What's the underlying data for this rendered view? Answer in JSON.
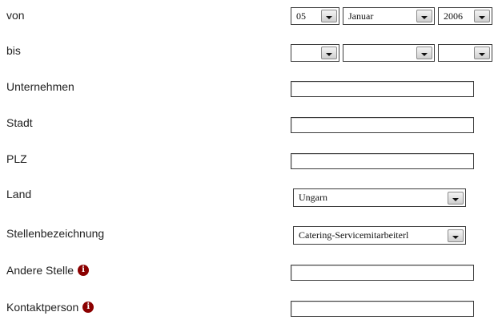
{
  "form": {
    "von_label": "von",
    "bis_label": "bis",
    "von": {
      "day": "05",
      "month": "Januar",
      "year": "2006"
    },
    "bis": {
      "day": "",
      "month": "",
      "year": ""
    },
    "unternehmen_label": "Unternehmen",
    "stadt_label": "Stadt",
    "plz_label": "PLZ",
    "land_label": "Land",
    "land_value": "Ungarn",
    "stellen_label": "Stellenbezeichnung",
    "stellen_value": "Catering-Servicemitarbeiterl",
    "andere_label": "Andere Stelle",
    "kontakt_label": "Kontaktperson",
    "info_glyph": "i",
    "unternehmen_value": "",
    "stadt_value": "",
    "plz_value": "",
    "andere_value": "",
    "kontakt_value": ""
  },
  "icons": {
    "info": "info-circle-icon",
    "dropdown": "chevron-down-icon"
  },
  "colors": {
    "info_icon": "#8b0000",
    "border": "#3c3c3c",
    "text": "#222222"
  }
}
